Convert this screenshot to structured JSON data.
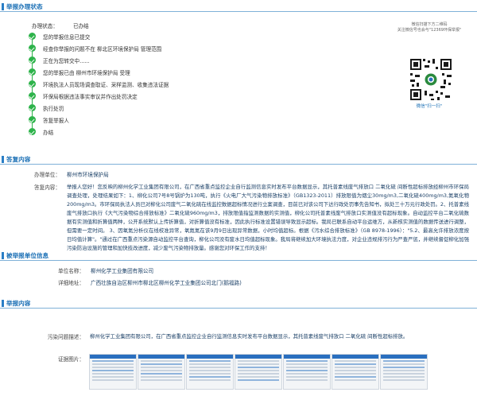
{
  "sections": {
    "status": "举报办理状态",
    "reply": "答复内容",
    "company": "被举报单位信息",
    "content": "举报内容"
  },
  "status": {
    "label": "办理状态：",
    "value": "已办结"
  },
  "steps": [
    "您的举报信息已提交",
    "经查你举报的问题不在 柳北区环境保护局 管理范围",
    "正在为您转交中......",
    "您的举报已由 柳州市环境保护局 受理",
    "环境执法人员现场调查取证、采样监测、收集违法证据",
    "环保局根据违法事实审议并作出处罚决定",
    "执行处罚",
    "答复举报人",
    "办结"
  ],
  "qr": {
    "caption1": "微信扫描下方二维码",
    "caption2": "关注微信号也会与\"12369环保举报\"",
    "caption3": "微信\"扫一扫\""
  },
  "reply": {
    "unit_label": "办理单位：",
    "unit": "柳州市环境保护局",
    "content_label": "答复内容：",
    "content": "举报人您好！您反映的柳州化学工业集团有限公司，在广西省重点监控企业自行监测信息实时发布平台数据显示，其托普素线废气排放口 二氧化硫 间断性超标排放经柳州市环保局调查处理，处理结果如下：1、柳化公司7号8号锅炉为130吨，执行《火电厂大气污染物排放标准》（GB1323-2011）排放限值为烟尘30mg/m3,二氧化硫400mg/m3,氮氧化物200mg/m3。市环保局执法人员已对柳化公司废气二氧化硫在线监控数据超标情况进行立案调查，目前已对该公司下达行政处罚事先告知书，拟处三十万元行政处罚。2、托普素线废气排放口执行《大气污染物综合排放标准》二氧化硫960mg/m3，排放限值指监测数据的实测值，柳化公司托普素线废气排放口实测值没有超标现象。自动监控平台二氧化硫数据有实测值和折算值两种，公开系统默认上传折算值，对折算值没有标准，因此执行标准设置错误导致显示超标。我局已联系自动平台运维方，从新核实测值的数据传送进行调整，但需要一定时间。 3、因氧氮分析仪在线校准异常，氧氮氮在该9月9日出现异常数据，小时均值超标。根据《污水综合排放标准》（GB 8978-1996）：\"5.2、最高允许排放浓度按日均值计算\"。\"通过在广西重点污染源自动监控平台查询，柳化公司没有废水日均值超标现象。我局将继续加大环境执法力度，对企业违规排污行为严查严惩，并继续督促柳化加强污染防治设施的管理和加快技改进度，减少废气污染物排放量。感谢您对环保工作的支持！"
  },
  "company": {
    "name_label": "单位名称：",
    "name": "柳州化学工业集团有限公司",
    "address_label": "详细地址：",
    "address": "广西壮族自治区柳州市柳北区柳州化学工业集团公司北门(鹅福路)"
  },
  "content": {
    "desc_label": "污染问题描述：",
    "desc": "柳州化学工业集团有限公司，在广西省重点监控企业自行监测信息实时发布平台数据显示，其托普素线废气排放口 二氧化硫 间断性超标排放。",
    "pics_label": "证据图片："
  },
  "colors": {
    "accent": "#1a6fb5",
    "success": "#2db34a",
    "value_text": "#1a3f66"
  }
}
